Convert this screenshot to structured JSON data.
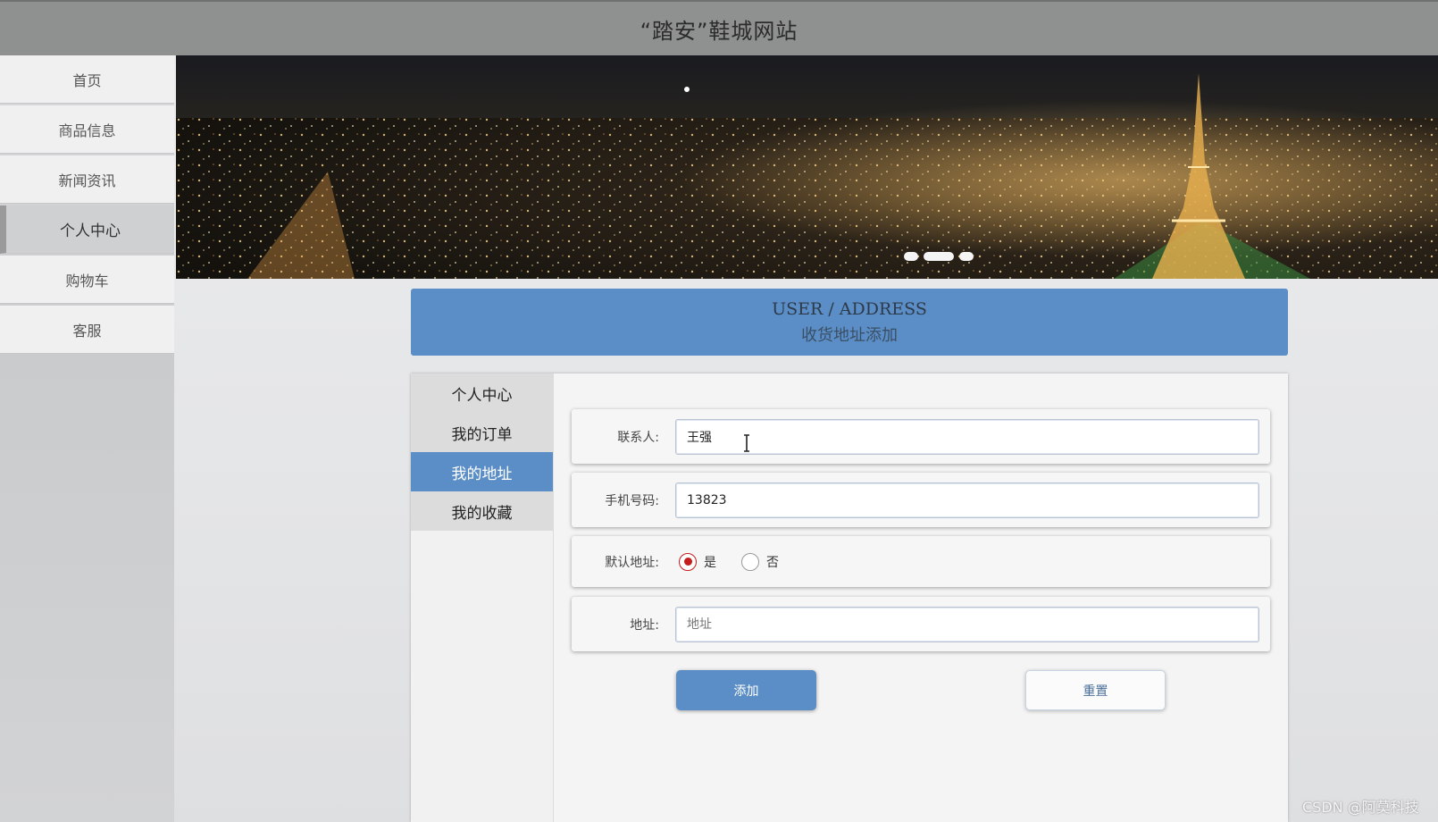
{
  "site": {
    "title": "“踏安”鞋城网站"
  },
  "left_nav": {
    "items": [
      {
        "label": "首页"
      },
      {
        "label": "商品信息"
      },
      {
        "label": "新闻资讯"
      },
      {
        "label": "个人中心",
        "active": true
      },
      {
        "label": "购物车"
      },
      {
        "label": "客服"
      }
    ]
  },
  "banner": {
    "slide_count": 3,
    "active_slide": 2
  },
  "section_header": {
    "en": "USER / ADDRESS",
    "zh": "收货地址添加"
  },
  "user_menu": {
    "items": [
      {
        "label": "个人中心"
      },
      {
        "label": "我的订单"
      },
      {
        "label": "我的地址",
        "active": true
      },
      {
        "label": "我的收藏"
      }
    ]
  },
  "form": {
    "contact": {
      "label": "联系人:",
      "value": "王强"
    },
    "phone": {
      "label": "手机号码:",
      "value": "13823"
    },
    "default_address": {
      "label": "默认地址:",
      "options": [
        {
          "label": "是",
          "checked": true
        },
        {
          "label": "否",
          "checked": false
        }
      ]
    },
    "address": {
      "label": "地址:",
      "value": "",
      "placeholder": "地址"
    }
  },
  "buttons": {
    "add": "添加",
    "reset": "重置"
  },
  "watermark": "CSDN @阿莫科技",
  "colors": {
    "accent": "#5b8ec6",
    "topbar": "#8f9090",
    "radio_checked": "#c41d1d"
  }
}
